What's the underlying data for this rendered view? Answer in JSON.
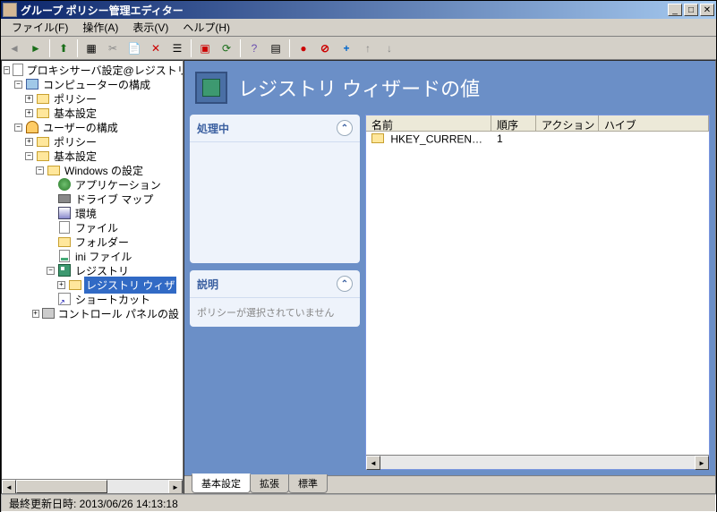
{
  "window": {
    "title": "グループ ポリシー管理エディター"
  },
  "menu": {
    "file": "ファイル(F)",
    "action": "操作(A)",
    "view": "表示(V)",
    "help": "ヘルプ(H)"
  },
  "tree": {
    "root": "プロキシサーバ設定@レジストリ [MI",
    "computer_config": "コンピューターの構成",
    "policy1": "ポリシー",
    "basic1": "基本設定",
    "user_config": "ユーザーの構成",
    "policy2": "ポリシー",
    "basic2": "基本設定",
    "windows_settings": "Windows の設定",
    "application": "アプリケーション",
    "drive_map": "ドライブ マップ",
    "environment": "環境",
    "files": "ファイル",
    "folder": "フォルダー",
    "ini_files": "ini ファイル",
    "registry": "レジストリ",
    "registry_wizard": "レジストリ ウィザ",
    "shortcut": "ショートカット",
    "control_panel": "コントロール パネルの設"
  },
  "content": {
    "title": "レジストリ ウィザードの値",
    "panel_processing": "処理中",
    "panel_desc": "説明",
    "desc_text": "ポリシーが選択されていません"
  },
  "list": {
    "columns": {
      "name": "名前",
      "order": "順序",
      "action": "アクション",
      "hive": "ハイブ"
    },
    "rows": [
      {
        "name": "HKEY_CURRENT_U...",
        "order": "1",
        "action": "",
        "hive": ""
      }
    ]
  },
  "tabs": {
    "basic": "基本設定",
    "extended": "拡張",
    "standard": "標準"
  },
  "status": {
    "text": "最終更新日時: 2013/06/26 14:13:18"
  }
}
